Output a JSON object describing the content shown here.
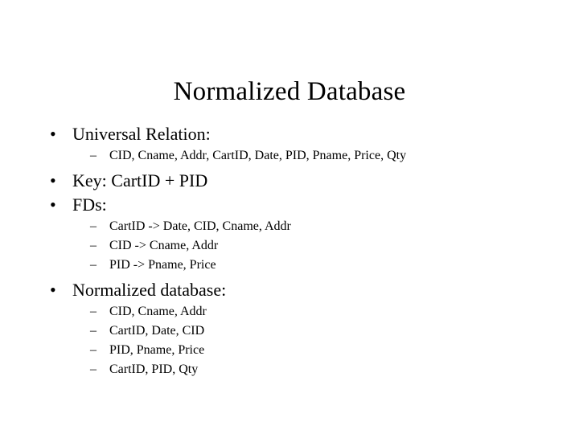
{
  "slide": {
    "title": "Normalized Database",
    "background_color": "#ffffff",
    "text_color": "#000000",
    "bullet_glyph": "•",
    "sub_bullet_glyph": "–",
    "sections": [
      {
        "heading": "Universal Relation:",
        "items": [
          "CID, Cname, Addr, CartID, Date, PID, Pname, Price, Qty"
        ]
      },
      {
        "heading": "Key: CartID + PID",
        "items": []
      },
      {
        "heading": "FDs:",
        "items": [
          "CartID -> Date, CID, Cname, Addr",
          "CID -> Cname, Addr",
          "PID -> Pname, Price"
        ]
      },
      {
        "heading": "Normalized database:",
        "items": [
          "CID, Cname, Addr",
          "CartID, Date, CID",
          "PID, Pname, Price",
          "CartID, PID, Qty"
        ]
      }
    ]
  }
}
